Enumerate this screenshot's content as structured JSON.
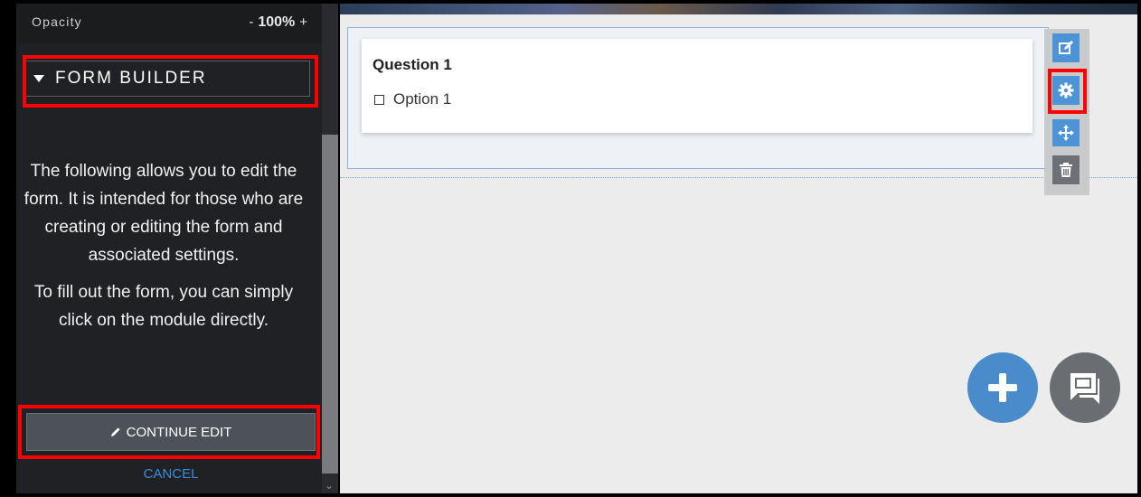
{
  "panel": {
    "opacity_label": "Opacity",
    "opacity_minus": "-",
    "opacity_value": "100%",
    "opacity_plus": "+",
    "section_title": "FORM BUILDER",
    "description_1": "The following allows you to edit the form. It is intended for those who are creating or editing the form and associated settings.",
    "description_2": "To fill out the form, you can simply click on the module directly.",
    "continue_label": "CONTINUE EDIT",
    "cancel_label": "CANCEL"
  },
  "form": {
    "question_title": "Question 1",
    "option_label": "Option 1"
  },
  "toolbar": {
    "icons": [
      "edit-icon",
      "gear-icon",
      "move-icon",
      "trash-icon"
    ]
  },
  "fabs": {
    "icons": [
      "plus-icon",
      "chat-icon"
    ]
  },
  "colors": {
    "panel_bg": "#202124",
    "accent_blue": "#4d94d6",
    "highlight_red": "#ff0000",
    "cancel_link": "#3b8dd6"
  }
}
